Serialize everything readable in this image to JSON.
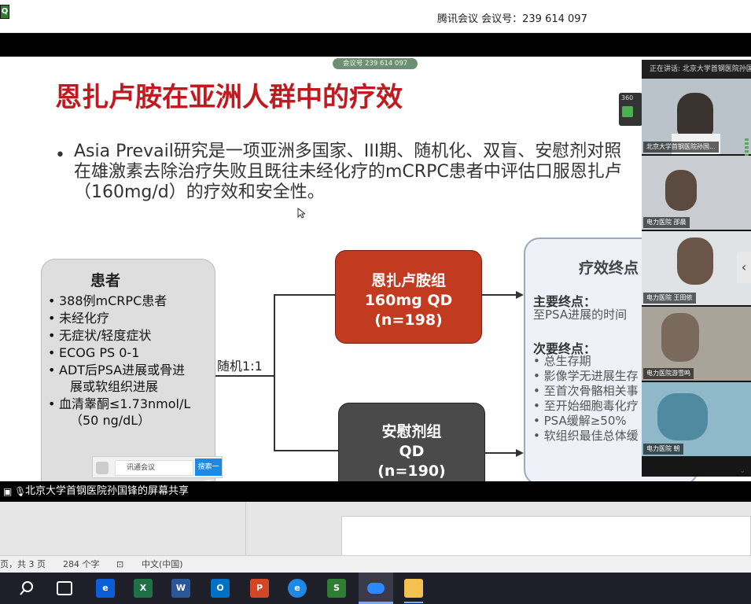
{
  "window": {
    "meeting_title": "腾讯会议 会议号：239 614 097",
    "meeting_pill": "会议号 239 614 097"
  },
  "slide": {
    "title": "恩扎卢胺在亚洲人群中的疗效",
    "bullet": [
      "Asia Prevail研究是一项亚洲多国家、III期、随机化、双盲、安慰剂对照",
      "在雄激素去除治疗失败且既往未经化疗的mCRPC患者中评估口服恩扎卢",
      "（160mg/d）的疗效和安全性。"
    ],
    "patients": {
      "title": "患者",
      "items": [
        "388例mCRPC患者",
        "未经化疗",
        "无症状/轻度症状",
        "ECOG PS 0-1",
        "ADT后PSA进展或骨进",
        "展或软组织进展",
        "血清睾酮≤1.73nmol/L",
        "（50 ng/dL）"
      ]
    },
    "randomize_label": "随机1:1",
    "enz_group": [
      "恩扎卢胺组",
      "160mg QD",
      "(n=198)"
    ],
    "placebo_group": [
      "安慰剂组",
      "QD",
      "(n=190)"
    ],
    "endpoints": {
      "title": "疗效终点",
      "primary_head": "主要终点：",
      "primary": "至PSA进展的时间",
      "secondary_head": "次要终点：",
      "secondary": [
        "总生存期",
        "影像学无进展生存",
        "至首次骨骼相关事",
        "至开始细胞毒化疗",
        "PSA缓解≥50%",
        "软组织最佳总体缓"
      ]
    },
    "side_badge": "360"
  },
  "participants": {
    "header": "正在讲话: 北京大学首钢医院孙国",
    "tiles": [
      {
        "label": "北京大学首钢医院孙国..."
      },
      {
        "label": "电力医院 邵晨"
      },
      {
        "label": "电力医院 王田依"
      },
      {
        "label": "电力医院游雪鸣"
      },
      {
        "label": "电力医院 朝"
      }
    ]
  },
  "popup": {
    "field": "讯通会议",
    "button": "搜索一下"
  },
  "share_status": "北京大学首钢医院孙国锋的屏幕共享",
  "word_status": {
    "pages": "页，共 3 页",
    "words": "284 个字",
    "lang": "中文(中国)"
  },
  "colors": {
    "title_red": "#c0191f",
    "enz_box": "#c23a1f",
    "placebo_box": "#4a4a4a"
  }
}
